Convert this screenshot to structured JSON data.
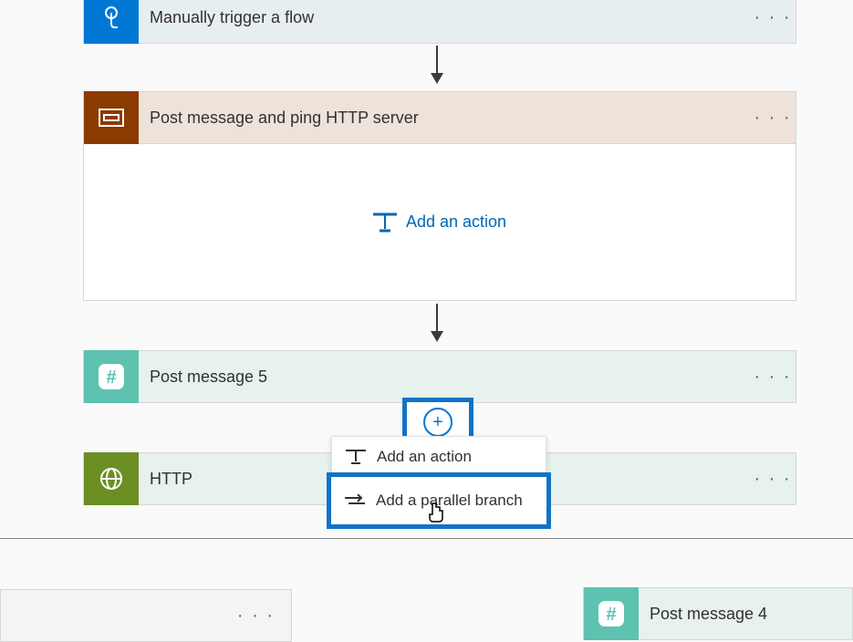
{
  "trigger": {
    "title": "Manually trigger a flow"
  },
  "scope": {
    "title": "Post message and ping HTTP server",
    "add_action": "Add an action"
  },
  "step1": {
    "title": "Post message 5"
  },
  "step2": {
    "title": "HTTP"
  },
  "menu": {
    "add_action": "Add an action",
    "add_parallel": "Add a parallel branch"
  },
  "bottom": {
    "title": "Post message 4"
  }
}
